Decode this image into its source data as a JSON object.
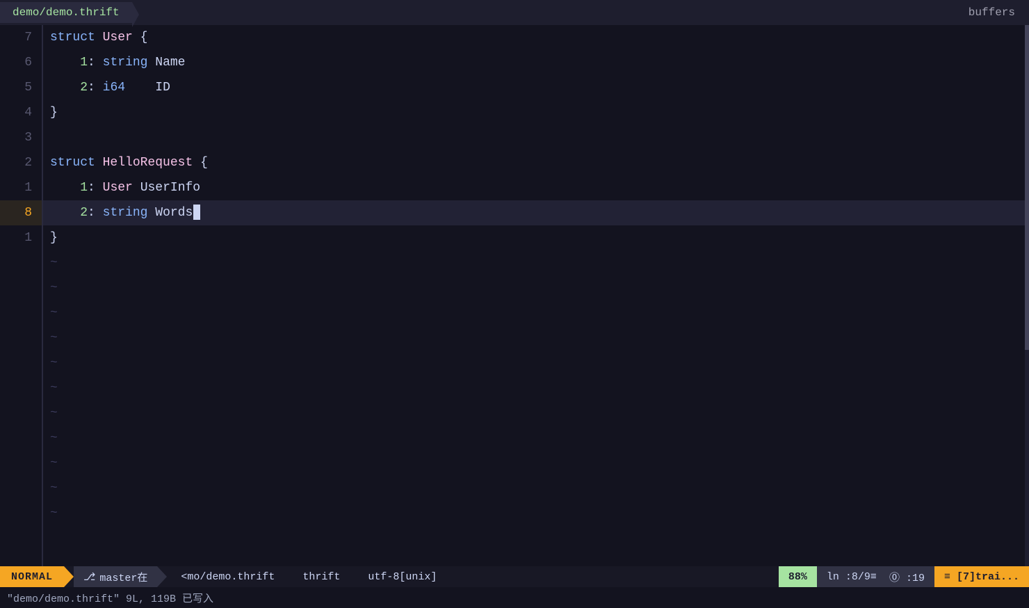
{
  "titlebar": {
    "tab_label": "demo/demo.thrift",
    "buffers_label": "buffers"
  },
  "code": {
    "lines": [
      {
        "num": "7",
        "active": false,
        "tilde": false,
        "content": "struct User {"
      },
      {
        "num": "6",
        "active": false,
        "tilde": false,
        "content": "    1: string Name"
      },
      {
        "num": "5",
        "active": false,
        "tilde": false,
        "content": "    2: i64    ID"
      },
      {
        "num": "4",
        "active": false,
        "tilde": false,
        "content": "}"
      },
      {
        "num": "3",
        "active": false,
        "tilde": false,
        "content": ""
      },
      {
        "num": "2",
        "active": false,
        "tilde": false,
        "content": "struct HelloRequest {"
      },
      {
        "num": "1",
        "active": false,
        "tilde": false,
        "content": "    1: User UserInfo"
      },
      {
        "num": "8",
        "active": true,
        "tilde": false,
        "content": "    2: string Words"
      },
      {
        "num": "1",
        "active": false,
        "tilde": false,
        "content": "}"
      }
    ],
    "tildes": [
      "~",
      "~",
      "~",
      "~",
      "~",
      "~",
      "~",
      "~",
      "~",
      "~",
      "~",
      "~",
      "~"
    ]
  },
  "statusbar": {
    "mode": "NORMAL",
    "git_icon": "⎇",
    "git_branch": "master在",
    "file_path": "<mo/demo.thrift",
    "file_type": "thrift",
    "encoding": "utf-8[unix]",
    "progress": "88%",
    "position": "ln :8/9≡",
    "col": "⓪ :19",
    "trail": "≡ [7]trai..."
  },
  "cmdline": {
    "text": "\"demo/demo.thrift\" 9L, 119B 已写入"
  }
}
